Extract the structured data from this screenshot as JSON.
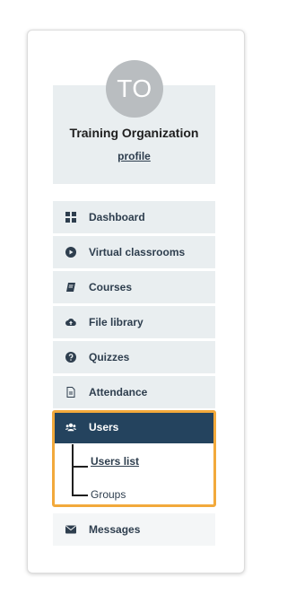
{
  "profile": {
    "avatar_initials": "TO",
    "organization_name": "Training Organization",
    "profile_link": "profile"
  },
  "nav": {
    "dashboard": "Dashboard",
    "virtual_classrooms": "Virtual classrooms",
    "courses": "Courses",
    "file_library": "File library",
    "quizzes": "Quizzes",
    "attendance": "Attendance",
    "users": "Users",
    "messages": "Messages"
  },
  "users_submenu": {
    "users_list": "Users list",
    "groups": "Groups"
  },
  "colors": {
    "panel_bg": "#e9eef0",
    "active_bg": "#24435e",
    "highlight_border": "#f2a93b",
    "text": "#2e3e4e"
  },
  "icons": {
    "dashboard": "grid-icon",
    "virtual_classrooms": "play-circle-icon",
    "courses": "book-icon",
    "file_library": "cloud-upload-icon",
    "quizzes": "question-circle-icon",
    "attendance": "document-icon",
    "users": "users-icon",
    "messages": "envelope-icon"
  }
}
